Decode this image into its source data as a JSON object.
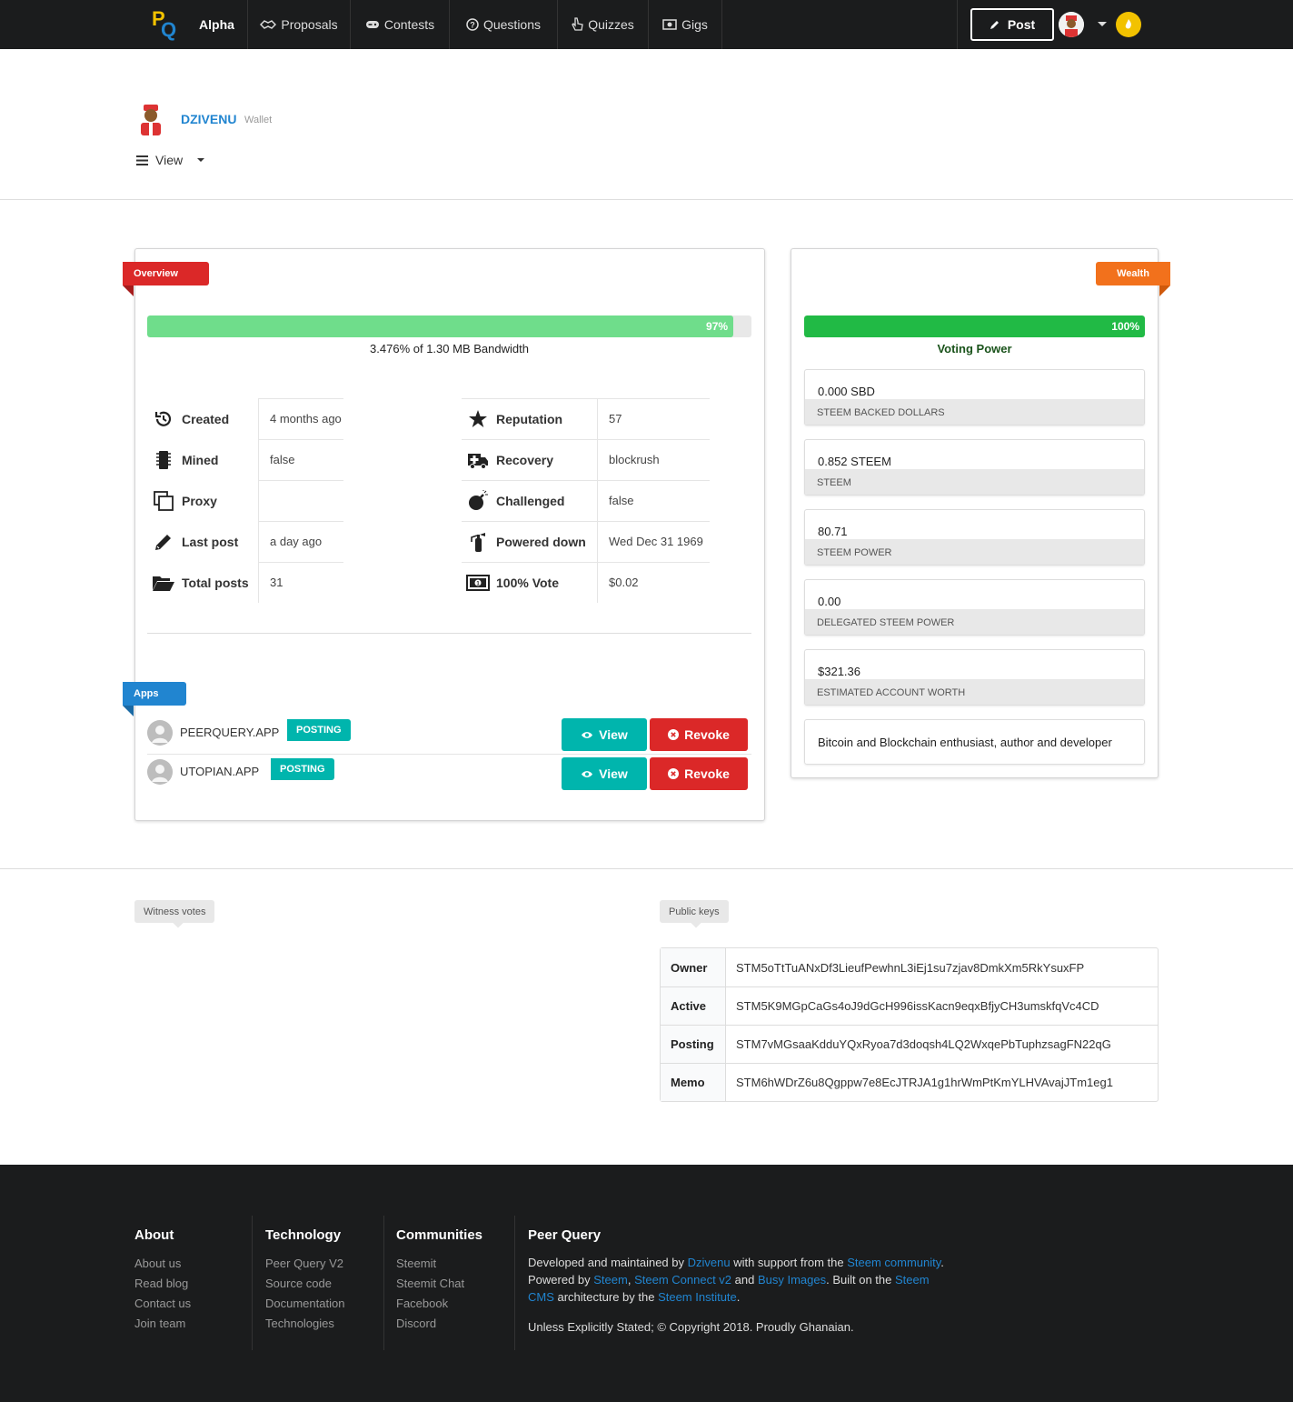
{
  "nav": {
    "logo_p": "P",
    "logo_q": "Q",
    "alpha": "Alpha",
    "items": [
      {
        "label": "Proposals",
        "icon": "handshake-icon"
      },
      {
        "label": "Contests",
        "icon": "gamepad-icon"
      },
      {
        "label": "Questions",
        "icon": "question-circle-icon"
      },
      {
        "label": "Quizzes",
        "icon": "pointer-hand-icon"
      },
      {
        "label": "Gigs",
        "icon": "money-bill-icon"
      }
    ],
    "post_label": "Post"
  },
  "profile": {
    "name": "DZIVENU",
    "subtitle": "Wallet",
    "view_label": "View"
  },
  "overview": {
    "ribbon": "Overview",
    "bandwidth_percent": 97,
    "bandwidth_percent_label": "97%",
    "bandwidth_label": "3.476% of 1.30 MB Bandwidth",
    "left_stats": [
      {
        "key": "Created",
        "value": "4 months ago",
        "icon": "history-icon"
      },
      {
        "key": "Mined",
        "value": "false",
        "icon": "microchip-icon"
      },
      {
        "key": "Proxy",
        "value": "",
        "icon": "clone-icon"
      },
      {
        "key": "Last post",
        "value": "a day ago",
        "icon": "pencil-icon"
      },
      {
        "key": "Total posts",
        "value": "31",
        "icon": "folder-open-icon"
      }
    ],
    "right_stats": [
      {
        "key": "Reputation",
        "value": "57",
        "icon": "star-icon"
      },
      {
        "key": "Recovery",
        "value": "blockrush",
        "icon": "ambulance-icon"
      },
      {
        "key": "Challenged",
        "value": "false",
        "icon": "bomb-icon"
      },
      {
        "key": "Powered down",
        "value": "Wed Dec 31 1969",
        "icon": "fire-extinguisher-icon"
      },
      {
        "key": "100% Vote",
        "value": "$0.02",
        "icon": "money-icon"
      }
    ]
  },
  "apps": {
    "ribbon": "Apps",
    "items": [
      {
        "name": "PEERQUERY.APP",
        "tag": "POSTING",
        "view": "View",
        "revoke": "Revoke"
      },
      {
        "name": "UTOPIAN.APP",
        "tag": "POSTING",
        "view": "View",
        "revoke": "Revoke"
      }
    ]
  },
  "wealth": {
    "ribbon": "Wealth",
    "voting_power_percent": 100,
    "voting_power_percent_label": "100%",
    "voting_power_label": "Voting Power",
    "items": [
      {
        "value": "0.000 SBD",
        "label": "STEEM BACKED DOLLARS"
      },
      {
        "value": "0.852 STEEM",
        "label": "STEEM"
      },
      {
        "value": "80.71",
        "label": "STEEM POWER"
      },
      {
        "value": "0.00",
        "label": "DELEGATED STEEM POWER"
      },
      {
        "value": "$321.36",
        "label": "ESTIMATED ACCOUNT WORTH"
      }
    ],
    "bio": "Bitcoin and Blockchain enthusiast, author and developer"
  },
  "witness_votes_label": "Witness votes",
  "public_keys": {
    "label": "Public keys",
    "rows": [
      {
        "name": "Owner",
        "key": "STM5oTtTuANxDf3LieufPewhnL3iEj1su7zjav8DmkXm5RkYsuxFP"
      },
      {
        "name": "Active",
        "key": "STM5K9MGpCaGs4oJ9dGcH996issKacn9eqxBfjyCH3umskfqVc4CD"
      },
      {
        "name": "Posting",
        "key": "STM7vMGsaaKdduYQxRyoa7d3doqsh4LQ2WxqePbTuphzsagFN22qG"
      },
      {
        "name": "Memo",
        "key": "STM6hWDrZ6u8Qgppw7e8EcJTRJA1g1hrWmPtKmYLHVAvajJTm1eg1"
      }
    ]
  },
  "footer": {
    "about": {
      "title": "About",
      "links": [
        "About us",
        "Read blog",
        "Contact us",
        "Join team"
      ]
    },
    "technology": {
      "title": "Technology",
      "links": [
        "Peer Query V2",
        "Source code",
        "Documentation",
        "Technologies"
      ]
    },
    "communities": {
      "title": "Communities",
      "links": [
        "Steemit",
        "Steemit Chat",
        "Facebook",
        "Discord"
      ]
    },
    "peerquery": {
      "title": "Peer Query",
      "t1": "Developed and maintained by ",
      "l1": "Dzivenu",
      "t2": " with support from the ",
      "l2": "Steem community",
      "t3": ". Powered by ",
      "l3": "Steem",
      "t4": ", ",
      "l4": "Steem Connect v2",
      "t5": " and ",
      "l5": "Busy Images",
      "t6": ". Built on the ",
      "l6": "Steem CMS",
      "t7": " architecture by the ",
      "l7": "Steem Institute",
      "t8": ".",
      "copyright": "Unless Explicitly Stated; © Copyright 2018. Proudly Ghanaian."
    }
  }
}
